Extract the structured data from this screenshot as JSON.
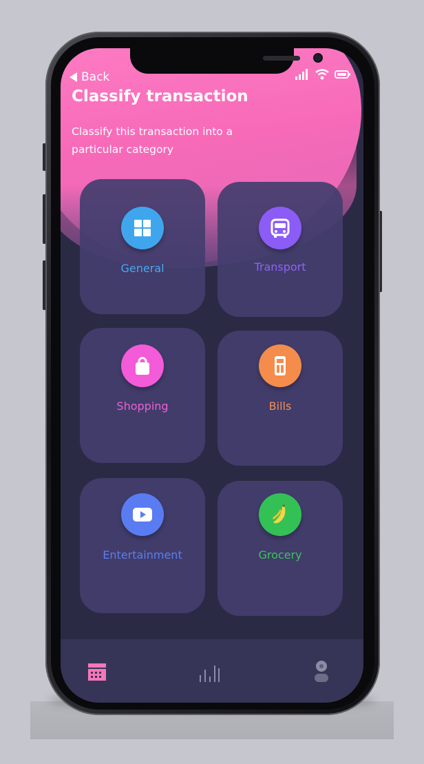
{
  "header": {
    "back_label": "Back",
    "title": "Classify transaction",
    "subtitle": "Classify this transaction into a particular category"
  },
  "status_bar": {
    "icons": [
      "cellular-signal-icon",
      "wifi-icon",
      "battery-icon"
    ]
  },
  "categories": [
    {
      "label": "General",
      "icon": "grid-icon",
      "color": "#3fa6ee",
      "label_color": "#4aa8f0"
    },
    {
      "label": "Transport",
      "icon": "bus-icon",
      "color": "#8b5cf6",
      "label_color": "#8f63f3"
    },
    {
      "label": "Shopping",
      "icon": "shopping-bag-icon",
      "color": "#f35bd9",
      "label_color": "#ee5fd6"
    },
    {
      "label": "Bills",
      "icon": "receipt-icon",
      "color": "#f48c4b",
      "label_color": "#f28f55"
    },
    {
      "label": "Entertainment",
      "icon": "play-video-icon",
      "color": "#5a7cf2",
      "label_color": "#5b7ef0"
    },
    {
      "label": "Grocery",
      "icon": "banana-icon",
      "color": "#33c155",
      "label_color": "#3cc45b"
    }
  ],
  "bottom_nav": [
    {
      "name": "calendar-icon",
      "color": "#f477b8",
      "active": true
    },
    {
      "name": "stats-icon",
      "color": "#8d8ca6",
      "active": false
    },
    {
      "name": "profile-icon",
      "color": "#8d8ca6",
      "active": false
    }
  ],
  "colors": {
    "background": "#2b2a45",
    "card": "#433e6e",
    "accent_pink": "#f76ab8"
  }
}
